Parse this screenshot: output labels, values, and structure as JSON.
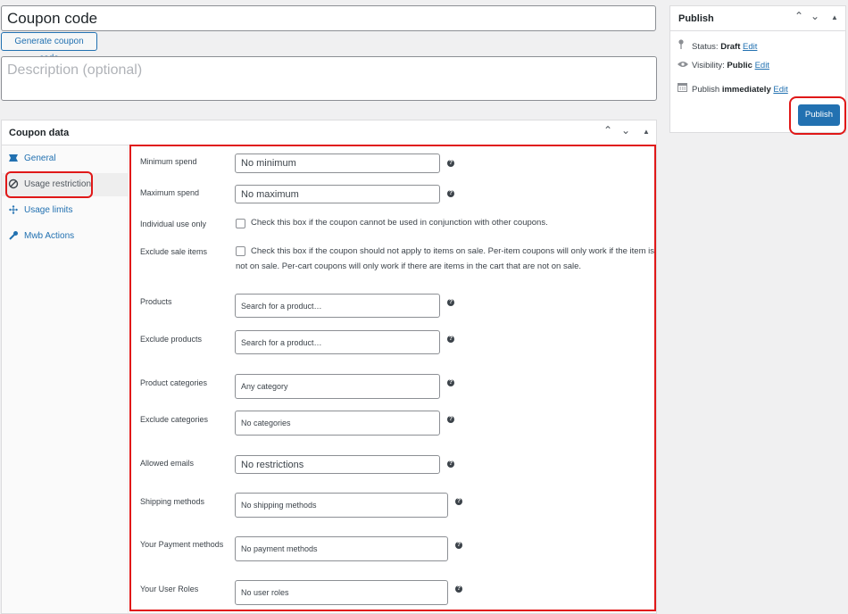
{
  "title_input": {
    "value": "Coupon code"
  },
  "generate_button": "Generate coupon code",
  "description": {
    "placeholder": "Description (optional)"
  },
  "coupon_panel": {
    "title": "Coupon data",
    "tabs": [
      {
        "label": "General",
        "icon": "ticket-icon"
      },
      {
        "label": "Usage restriction",
        "icon": "block-icon",
        "active": true
      },
      {
        "label": "Usage limits",
        "icon": "move-icon"
      },
      {
        "label": "Mwb Actions",
        "icon": "wrench-icon"
      }
    ]
  },
  "restriction": {
    "minimum_spend": {
      "label": "Minimum spend",
      "placeholder": "No minimum"
    },
    "maximum_spend": {
      "label": "Maximum spend",
      "placeholder": "No maximum"
    },
    "individual_use": {
      "label": "Individual use only",
      "text": "Check this box if the coupon cannot be used in conjunction with other coupons."
    },
    "exclude_sale": {
      "label": "Exclude sale items",
      "text_line1": "Check this box if the coupon should not apply to items on sale. Per-item coupons will only work if the item is",
      "text_line2": "not on sale. Per-cart coupons will only work if there are items in the cart that are not on sale."
    },
    "products": {
      "label": "Products",
      "placeholder": "Search for a product…"
    },
    "exclude_products": {
      "label": "Exclude products",
      "placeholder": "Search for a product…"
    },
    "product_categories": {
      "label": "Product categories",
      "placeholder": "Any category"
    },
    "exclude_categories": {
      "label": "Exclude categories",
      "placeholder": "No categories"
    },
    "allowed_emails": {
      "label": "Allowed emails",
      "placeholder": "No restrictions"
    },
    "shipping_methods": {
      "label": "Shipping methods",
      "placeholder": "No shipping methods"
    },
    "payment_methods": {
      "label": "Your Payment methods",
      "placeholder": "No payment methods"
    },
    "user_roles": {
      "label": "Your User Roles",
      "placeholder": "No user roles"
    }
  },
  "publish": {
    "title": "Publish",
    "status_label": "Status:",
    "status_value": "Draft",
    "visibility_label": "Visibility:",
    "visibility_value": "Public",
    "publish_label": "Publish",
    "publish_value": "immediately",
    "edit": "Edit",
    "button": "Publish"
  },
  "colors": {
    "accent": "#2271b1",
    "highlight": "#e01818"
  }
}
